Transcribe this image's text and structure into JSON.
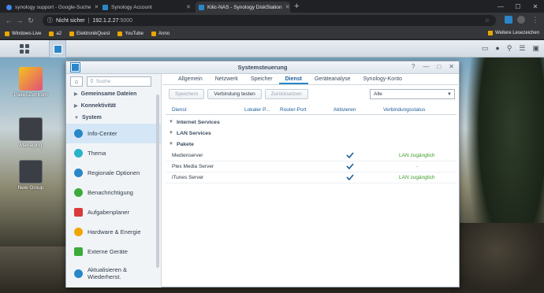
{
  "browser": {
    "tabs": [
      {
        "title": "synology support - Google-Suche",
        "fav": "#4285f4"
      },
      {
        "title": "Synology Account",
        "fav": "#2a86c9"
      },
      {
        "title": "Kilic-NAS - Synology DiskStation",
        "fav": "#2a86c9"
      }
    ],
    "url_warning": "Nicht sicher",
    "url_host": "192.1.2.27",
    "url_port": ":5000",
    "bookmarks": [
      {
        "label": "Windows-Live",
        "color": "#e6a700"
      },
      {
        "label": "a2",
        "color": "#e6a700"
      },
      {
        "label": "ElektronikQuest",
        "color": "#e6a700"
      },
      {
        "label": "YouTube",
        "color": "#e6a700"
      },
      {
        "label": "Anno",
        "color": "#e6a700"
      }
    ],
    "other_bookmarks": "Weitere Lesezeichen"
  },
  "desktop": {
    "icons": [
      {
        "label": "Paket-Zentrum"
      },
      {
        "label": "Managing"
      },
      {
        "label": "New Group"
      }
    ]
  },
  "window": {
    "title": "Systemsteuerung",
    "search_placeholder": "Suche",
    "sidebar": {
      "sections": [
        "Gemeinsame Dateien",
        "Konnektivität",
        "System"
      ],
      "items": [
        {
          "label": "Info-Center",
          "color": "#2a86c9"
        },
        {
          "label": "Thema",
          "color": "#2bb3c9"
        },
        {
          "label": "Regionale Optionen",
          "color": "#2a86c9"
        },
        {
          "label": "Benachrichtigung",
          "color": "#3cab3c"
        },
        {
          "label": "Aufgabenplaner",
          "color": "#d93a3a"
        },
        {
          "label": "Hardware & Energie",
          "color": "#f0a500"
        },
        {
          "label": "Externe Geräte",
          "color": "#3cab3c"
        },
        {
          "label": "Aktualisieren &",
          "label2": "Wiederherst.",
          "color": "#2a86c9"
        }
      ]
    },
    "tabs": [
      "Allgemein",
      "Netzwerk",
      "Speicher",
      "Dienst",
      "Geräteanalyse",
      "Synology-Konto"
    ],
    "active_tab": "Dienst",
    "toolbar": {
      "save": "Speichern",
      "test": "Verbindung testen",
      "reset": "Zurücksetzen"
    },
    "filter_value": "Alle",
    "columns": [
      "Dienst",
      "Lokaler P...",
      "Router-Port",
      "Aktivieren",
      "Verbindungsstatus"
    ],
    "groups": [
      "Internet Services",
      "LAN Services",
      "Pakete"
    ],
    "rows": [
      {
        "name": "Medienserver",
        "enabled": true,
        "status": "LAN zugänglich"
      },
      {
        "name": "Plex Media Server",
        "enabled": true,
        "status": "-"
      },
      {
        "name": "iTunes Server",
        "enabled": true,
        "status": "LAN zugänglich"
      }
    ]
  }
}
